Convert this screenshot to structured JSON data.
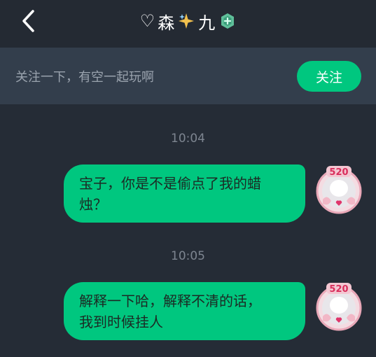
{
  "header": {
    "title_prefix": "♡",
    "title_name_1": "森",
    "title_name_2": "九",
    "back_icon": "chevron-left-icon",
    "sparkle_icon": "sparkle-icon",
    "badge_icon": "verified-badge-icon"
  },
  "follow_bar": {
    "prompt": "关注一下，有空一起玩啊",
    "button_label": "关注"
  },
  "messages": [
    {
      "time": "10:04",
      "text_line_1": "宝子，你是不是偷点了我的蜡",
      "text_line_2": "烛？",
      "avatar_badge": "520"
    },
    {
      "time": "10:05",
      "text_line_1": "解释一下哈，解释不清的话，",
      "text_line_2": "我到时候挂人",
      "avatar_badge": "520"
    }
  ],
  "colors": {
    "background": "#252c36",
    "navbar": "#242a33",
    "follow_bar": "#333e4c",
    "accent": "#00c77f"
  }
}
